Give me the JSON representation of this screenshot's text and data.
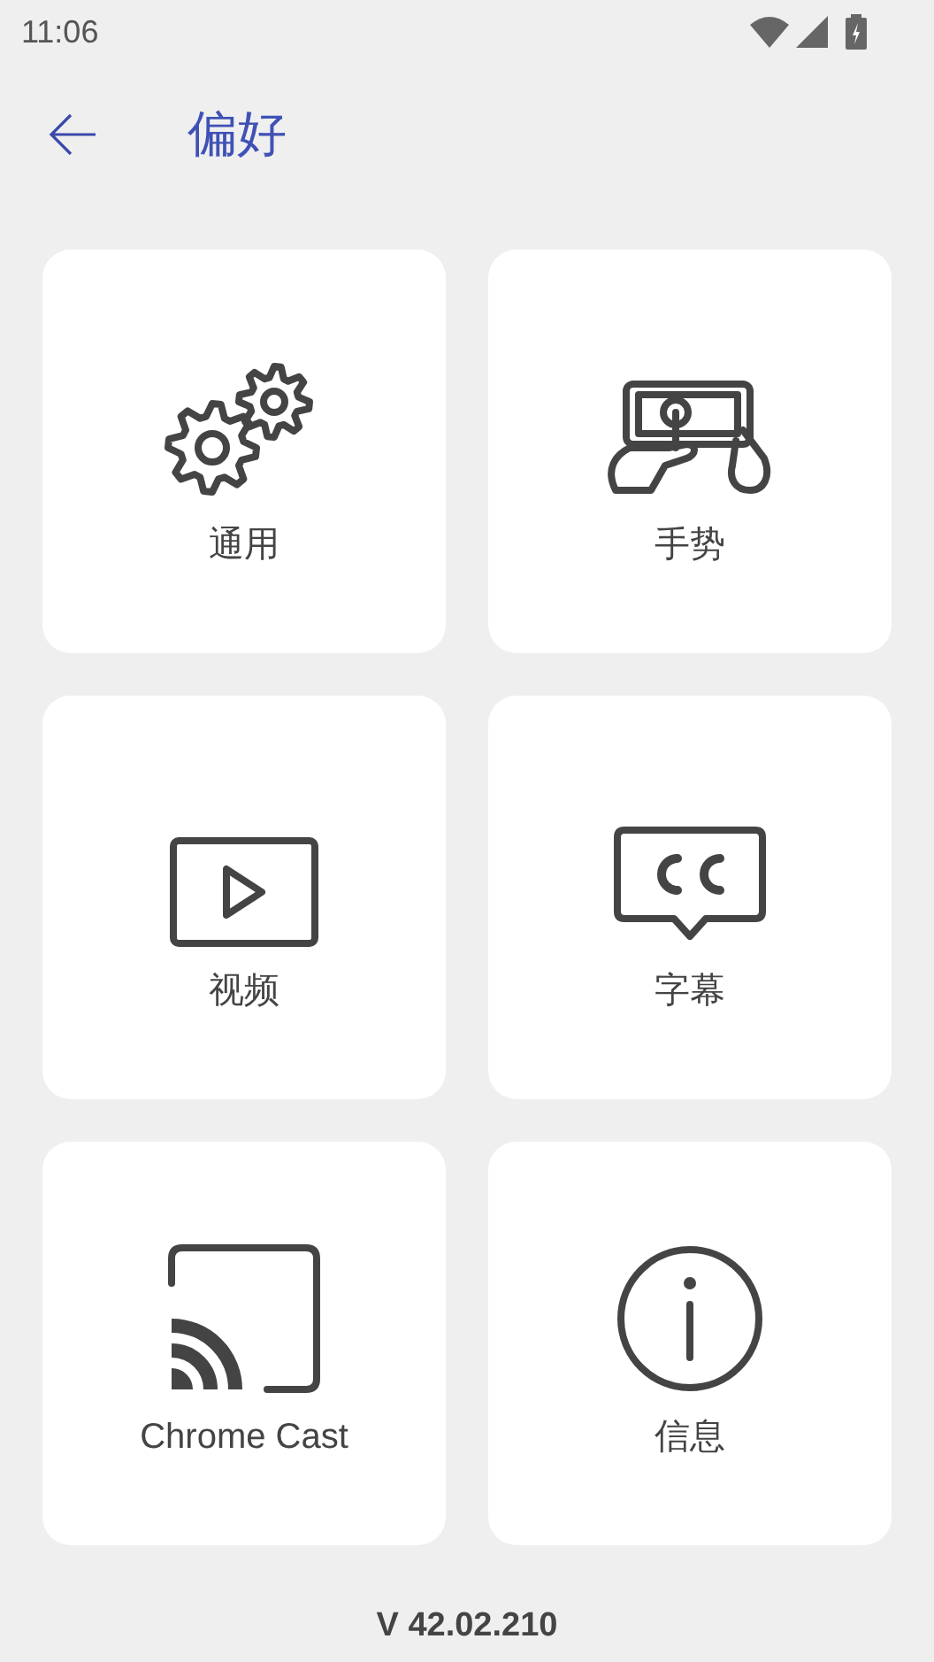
{
  "status_bar": {
    "time": "11:06"
  },
  "header": {
    "title": "偏好"
  },
  "items": [
    {
      "kind": "gears",
      "label": "通用"
    },
    {
      "kind": "gesture",
      "label": "手势"
    },
    {
      "kind": "video",
      "label": "视频"
    },
    {
      "kind": "subtitles",
      "label": "字幕"
    },
    {
      "kind": "cast",
      "label": "Chrome Cast"
    },
    {
      "kind": "info",
      "label": "信息"
    }
  ],
  "version": "V 42.02.210"
}
